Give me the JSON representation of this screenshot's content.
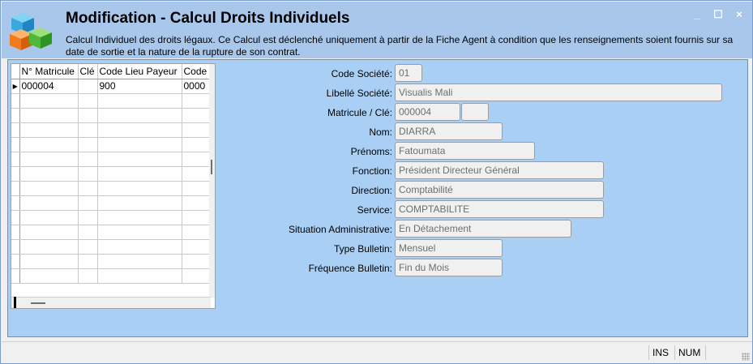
{
  "header": {
    "title": "Modification - Calcul Droits Individuels",
    "description": "Calcul Individuel des droits légaux. Ce Calcul est déclenché uniquement à partir de la Fiche Agent à condition que les renseignements soient fournis sur sa date de sortie et la nature de la rupture de son contrat.",
    "minimize": "_",
    "maximize": "☐",
    "close": "×"
  },
  "grid": {
    "columns": [
      "N° Matricule",
      "Clé",
      "Code Lieu Payeur",
      "Code"
    ],
    "rows": [
      [
        "000004",
        "",
        "900",
        "0000"
      ]
    ],
    "selected_indicator": "▶"
  },
  "form": {
    "code_societe": {
      "label": "Code Société:",
      "value": "01"
    },
    "libelle_societe": {
      "label": "Libellé Société:",
      "value": "Visualis Mali"
    },
    "matricule_cle": {
      "label": "Matricule / Clé:",
      "value": "000004",
      "cle": ""
    },
    "nom": {
      "label": "Nom:",
      "value": "DIARRA"
    },
    "prenoms": {
      "label": "Prénoms:",
      "value": "Fatoumata"
    },
    "fonction": {
      "label": "Fonction:",
      "value": "Président Directeur Général"
    },
    "direction": {
      "label": "Direction:",
      "value": "Comptabilité"
    },
    "service": {
      "label": "Service:",
      "value": "COMPTABILITE"
    },
    "situation": {
      "label": "Situation Administrative:",
      "value": "En Détachement"
    },
    "type_bulletin": {
      "label": "Type Bulletin:",
      "value": "Mensuel"
    },
    "frequence_bulletin": {
      "label": "Fréquence Bulletin:",
      "value": "Fin du Mois"
    }
  },
  "statusbar": {
    "ins": "INS",
    "num": "NUM"
  },
  "colors": {
    "header_bg": "#a9c7ea",
    "panel_bg": "#a9cff4",
    "field_bg": "#f0f0f0"
  }
}
